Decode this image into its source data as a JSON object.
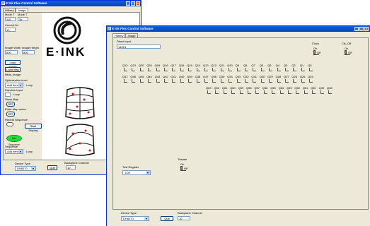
{
  "back_window": {
    "title": "E Ink Flex Control Software",
    "tabs": [
      "Hilbery",
      "Image"
    ],
    "fields": {
      "mode_a_label": "Mode T",
      "mode_b_label": "Mode T",
      "mode_a_value": "110",
      "mode_b_value": "3e",
      "current_label": "Current fld",
      "current_value": "10",
      "image_width_label": "Image Width",
      "image_height_label": "Image Height",
      "image_width_value": "600",
      "image_height_value": "800"
    },
    "buttons": {
      "load_image": "Load Image",
      "load_map": "Load Map",
      "start_display": "Start Display"
    },
    "labels": {
      "map_image": "Bkds_Image",
      "optimization_level": "Optimization level",
      "random_input": "Random Input",
      "show_map": "Show Map",
      "enter_map_areas": "Enter Map areas",
      "repeat_sequence": "Repeat Sequence",
      "sequence": "Sequence",
      "loop": "Loop",
      "off": "OFF",
      "device_type": "Device Type",
      "backplane_channel": "Backplane Channel",
      "green_button": "Run Sequence"
    },
    "combos": {
      "optimization": "Add item",
      "sequence": "Add item",
      "device": "DH8070",
      "backplane": "10"
    },
    "logo_text": "E·INK",
    "quit": "Quit"
  },
  "front_window": {
    "title": "E Ink Flex Control Software",
    "tabs": [
      "Hilbery",
      "Image"
    ],
    "direct_input_label": "Direct input",
    "direct_input_value": "14013",
    "clock_label": "Clock",
    "clk_label": "Clk_Off",
    "on_label": "On",
    "off_label": "Off",
    "row1": [
      "Q12",
      "Q13",
      "Q20",
      "Q33",
      "Q18",
      "Q16",
      "Q17",
      "Q16",
      "Q15",
      "Q14",
      "Q13",
      "Q12",
      "Q11",
      "Q10",
      "Q9",
      "Q8",
      "Q7",
      "Q6",
      "Q5",
      "Q4",
      "Q3",
      "Q2",
      "Q1",
      "Q0"
    ],
    "row2": [
      "Q47",
      "Q46",
      "Q45",
      "Q44",
      "Q43",
      "Q42",
      "Q41",
      "Q40",
      "Q39",
      "Q38",
      "Q37",
      "Q36",
      "Q35",
      "Q34",
      "Q33",
      "Q32",
      "Q31",
      "Q30",
      "Q29",
      "Q28",
      "Q27",
      "Q26",
      "Q25",
      "Q24"
    ],
    "row3": [
      "Q63",
      "Q62",
      "Q61",
      "Q60",
      "Q59",
      "Q58",
      "Q57",
      "Q56",
      "Q55",
      "Q54",
      "Q53",
      "Q52",
      "Q51",
      "Q50",
      "Q49",
      "Q48"
    ],
    "tristate_label": "Tristate",
    "test_register_label": "Test Register",
    "test_register_value": "TCR",
    "device_type_label": "Device Type",
    "device_value": "DH8070",
    "backplane_label": "Backplane Channel",
    "backplane_value": "10",
    "quit": "Quit"
  }
}
